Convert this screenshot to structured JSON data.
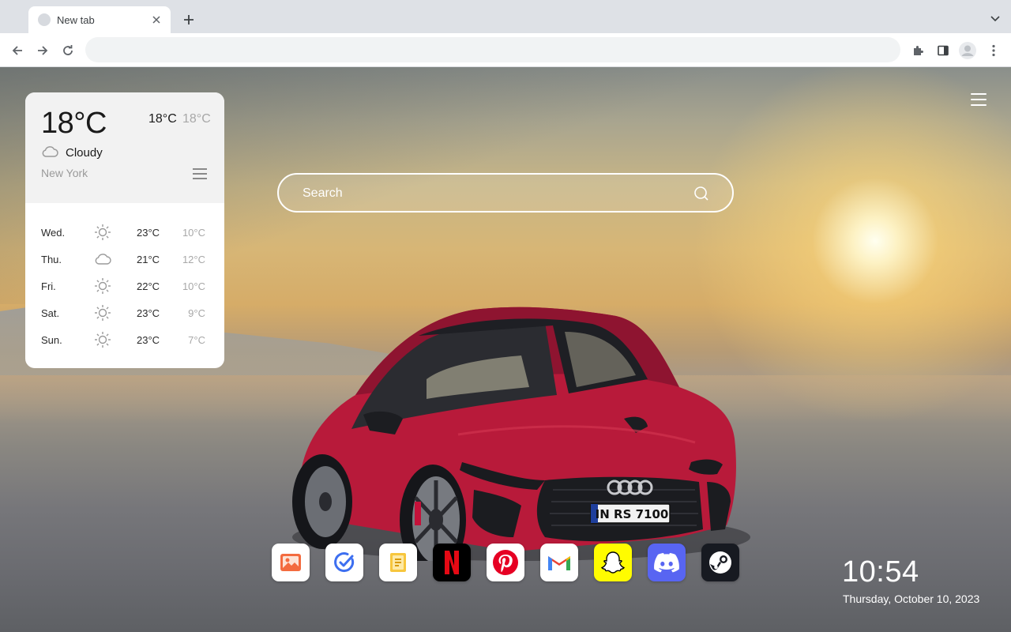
{
  "browser": {
    "tab_title": "New tab",
    "omnibox_value": ""
  },
  "weather": {
    "current_temp": "18°C",
    "high": "18°C",
    "low": "18°C",
    "condition": "Cloudy",
    "condition_icon": "cloud-icon",
    "city": "New York",
    "forecast": [
      {
        "day": "Wed.",
        "icon": "sun-icon",
        "high": "23°C",
        "low": "10°C"
      },
      {
        "day": "Thu.",
        "icon": "cloud-icon",
        "high": "21°C",
        "low": "12°C"
      },
      {
        "day": "Fri.",
        "icon": "sun-icon",
        "high": "22°C",
        "low": "10°C"
      },
      {
        "day": "Sat.",
        "icon": "sun-icon",
        "high": "23°C",
        "low": "9°C"
      },
      {
        "day": "Sun.",
        "icon": "sun-icon",
        "high": "23°C",
        "low": "7°C"
      }
    ]
  },
  "search": {
    "placeholder": "Search"
  },
  "car": {
    "plate": "IN RS 7100"
  },
  "dock": {
    "apps": [
      {
        "name": "photos",
        "icon": "photos-icon"
      },
      {
        "name": "tasks",
        "icon": "check-icon"
      },
      {
        "name": "notes",
        "icon": "notes-icon"
      },
      {
        "name": "netflix",
        "icon": "netflix-icon",
        "color": "#e50914"
      },
      {
        "name": "pinterest",
        "icon": "pinterest-icon",
        "color": "#e60023"
      },
      {
        "name": "gmail",
        "icon": "gmail-icon"
      },
      {
        "name": "snapchat",
        "icon": "snapchat-icon",
        "color": "#fffc00"
      },
      {
        "name": "discord",
        "icon": "discord-icon",
        "color": "#5865f2"
      },
      {
        "name": "steam",
        "icon": "steam-icon",
        "color": "#171a21"
      }
    ]
  },
  "clock": {
    "time": "10:54",
    "date": "Thursday, October 10, 2023"
  }
}
